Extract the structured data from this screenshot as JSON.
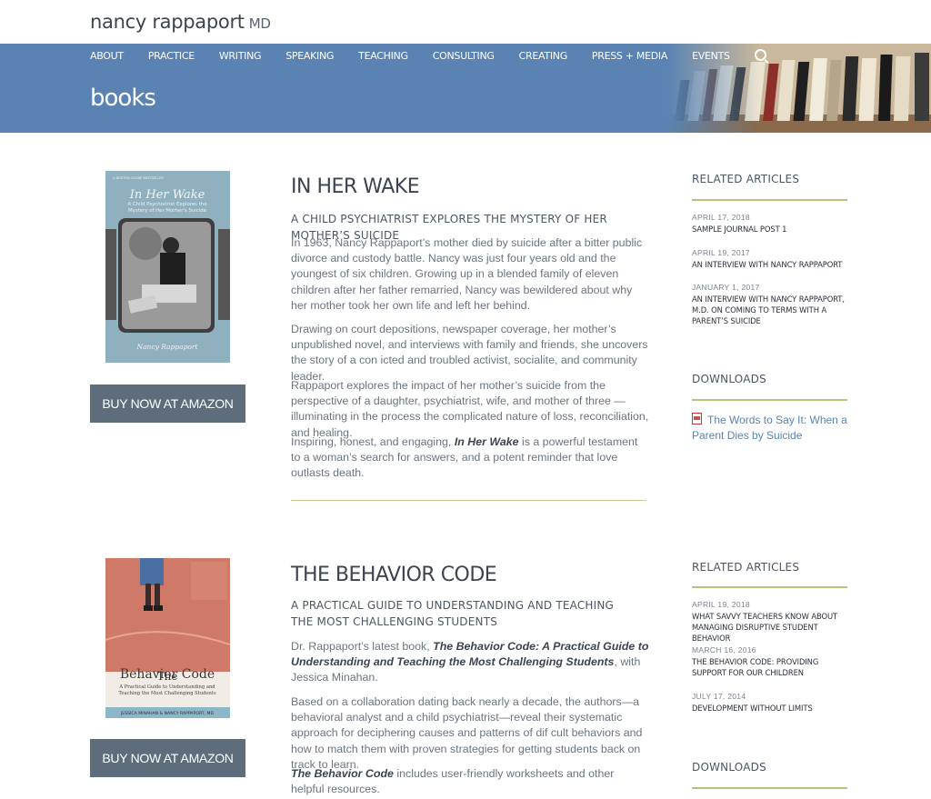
{
  "site": {
    "logo": "nancy rappaport",
    "logo_suffix": "MD"
  },
  "nav": {
    "items": [
      "ABOUT",
      "PRACTICE",
      "WRITING",
      "SPEAKING",
      "TEACHING",
      "CONSULTING",
      "CREATING",
      "PRESS + MEDIA",
      "EVENTS"
    ],
    "search_icon": "search-icon"
  },
  "page": {
    "heading": "books"
  },
  "books": [
    {
      "title": "IN HER WAKE",
      "subtitle": "A CHILD PSYCHIATRIST EXPLORES THE MYSTERY OF HER MOTHER’S SUICIDE",
      "buy_label": "BUY NOW AT AMAZON",
      "cover": {
        "tagline": "A BOSTON GLOBE BESTSELLER",
        "title": "In Her Wake",
        "subtitle": "A Child Psychiatrist Explores the Mystery of Her Mother's Suicide",
        "author": "Nancy Rappaport"
      },
      "paragraphs": [
        "In 1963, Nancy Rappaport’s mother died by suicide after a bitter public divorce and custody battle. Nancy was just four years old and the youngest of six children. Growing up in a blended family of eleven children after her father remarried, Nancy was bewildered about why her mother took her own life and left her behind.",
        "Drawing on court depositions, newspaper coverage, her mother’s unpublished novel, and interviews with family and friends, she uncovers the story of a con icted and troubled activist, socialite, and community leader.",
        "Rappaport explores the impact of her mother’s suicide from the perspective of a daughter, psychiatrist, wife, and mother of three — illuminating in the process the complicated nature of loss, reconciliation, and healing."
      ],
      "last_para": {
        "before": "Inspiring, honest, and engaging, ",
        "em": "In Her Wake",
        "after": " is a powerful testament to a woman’s search for answers, and a potent reminder that love outlasts death."
      },
      "related_heading": "RELATED ARTICLES",
      "related": [
        {
          "date": "APRIL 17, 2018",
          "title": "SAMPLE JOURNAL POST 1"
        },
        {
          "date": "APRIL 19, 2017",
          "title": "AN INTERVIEW WITH NANCY RAPPAPORT"
        },
        {
          "date": "JANUARY 1, 2017",
          "title": "AN INTERVIEW WITH NANCY RAPPAPORT, M.D. ON COMING TO TERMS WITH A PARENT’S SUICIDE"
        }
      ],
      "downloads_heading": "DOWNLOADS",
      "download_link": "The Words to Say It: When a Parent Dies by Suicide"
    },
    {
      "title": "THE BEHAVIOR CODE",
      "subtitle": "A PRACTICAL GUIDE TO UNDERSTANDING AND TEACHING THE MOST CHALLENGING STUDENTS",
      "buy_label": "BUY NOW AT AMAZON",
      "cover": {
        "title": "Behavior Code",
        "subtitle": "A Practical Guide to Understanding and Teaching the Most Challenging Students",
        "authors": "JESSICA MINAHAN & NANCY RAPPAPORT, MD"
      },
      "para1": {
        "before": "Dr. Rappaport’s latest book, ",
        "em": "The Behavior Code: A Practical Guide to Understanding and Teaching the Most Challenging Students",
        "after": ", with Jessica Minahan."
      },
      "para2": "Based on a collaboration dating back nearly a decade, the authors—a behavioral analyst and a child psychiatrist—reveal their systematic approach for deciphering causes and patterns of dif cult behaviors and how to match them with proven strategies for getting students back on track to learn.",
      "para3": {
        "em": "The Behavior Code",
        "after": " includes user-friendly worksheets and other helpful resources."
      },
      "related_heading": "RELATED ARTICLES",
      "related": [
        {
          "date": "APRIL 19, 2018",
          "title": "WHAT SAVVY TEACHERS KNOW ABOUT MANAGING DISRUPTIVE STUDENT BEHAVIOR"
        },
        {
          "date": "MARCH 16, 2016",
          "title": "THE BEHAVIOR CODE: PROVIDING SUPPORT FOR OUR CHILDREN"
        },
        {
          "date": "JULY 17, 2014",
          "title": "DEVELOPMENT WITHOUT LIMITS"
        }
      ],
      "downloads_heading": "DOWNLOADS"
    }
  ],
  "colors": {
    "banner": "#5a83b3",
    "button": "#5d6d7b",
    "accent_rule": "#b9c27b",
    "link": "#5a83b3"
  }
}
